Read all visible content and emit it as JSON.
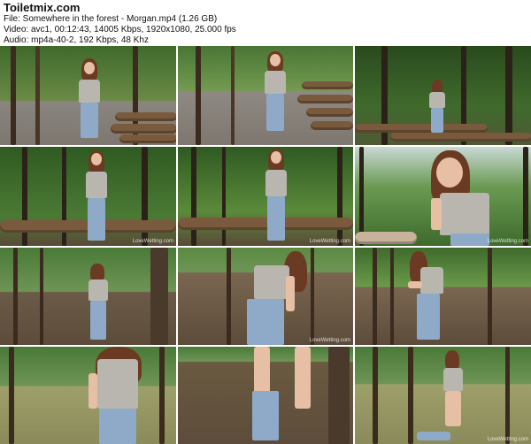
{
  "header": {
    "site": "Toiletmix.com",
    "file_line": "File: Somewhere in the forest - Morgan.mp4 (1.26 GB)",
    "video_line": "Video: avc1, 00:12:43, 14005 Kbps, 1920x1080, 25.000 fps",
    "audio_line": "Audio: mp4a-40-2, 192 Kbps, 48 Khz"
  },
  "thumbnails": {
    "watermark": "LoveWetting.com",
    "count": 12
  },
  "colors": {
    "forest_dark": "#2f4a22",
    "forest_light": "#5f8f3c",
    "ground": "#6b5a47",
    "road": "#8a8580"
  }
}
